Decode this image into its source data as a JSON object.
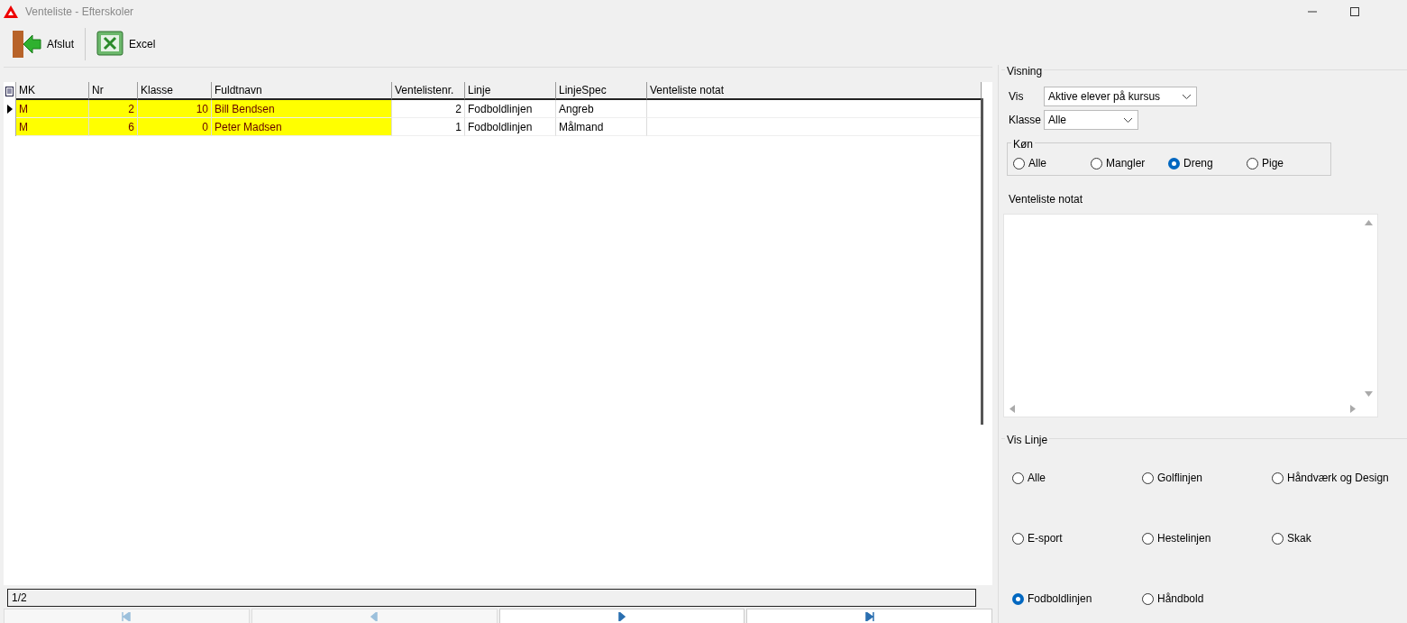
{
  "window": {
    "title": "Venteliste - Efterskoler"
  },
  "toolbar": [
    {
      "kind": "exit",
      "label": "Afslut"
    },
    {
      "kind": "excel",
      "label": "Excel"
    }
  ],
  "table": {
    "columns": [
      {
        "label": "MK",
        "numeric": false,
        "highlighted": true
      },
      {
        "label": "Nr",
        "numeric": true,
        "highlighted": true
      },
      {
        "label": "Klasse",
        "numeric": true,
        "highlighted": true
      },
      {
        "label": "Fuldtnavn",
        "numeric": false,
        "highlighted": true
      },
      {
        "label": "Ventelistenr.",
        "numeric": true,
        "highlighted": false
      },
      {
        "label": "Linje",
        "numeric": false,
        "highlighted": false
      },
      {
        "label": "LinjeSpec",
        "numeric": false,
        "highlighted": false
      },
      {
        "label": "Venteliste notat",
        "highlighted": false
      }
    ],
    "rows": [
      {
        "selected": true,
        "cells": [
          "M",
          "2",
          "10",
          "Bill Bendsen",
          "2",
          "Fodboldlinjen",
          "Angreb",
          ""
        ]
      },
      {
        "selected": false,
        "cells": [
          "M",
          "6",
          "0",
          "Peter Madsen",
          "1",
          "Fodboldlinjen",
          "Målmand",
          ""
        ]
      }
    ]
  },
  "status_bar": "1/2",
  "navigator": [
    {
      "kind": "first",
      "disabled": true
    },
    {
      "kind": "prev",
      "disabled": true
    },
    {
      "kind": "next",
      "disabled": false
    },
    {
      "kind": "last",
      "disabled": false
    }
  ],
  "visning": {
    "title": "Visning",
    "vis_label": "Vis",
    "vis_value": "Aktive elever på kursus",
    "klasse_label": "Klasse",
    "klasse_value": "Alle",
    "kon": {
      "title": "Køn",
      "options": [
        {
          "label": "Alle",
          "selected": false
        },
        {
          "label": "Mangler",
          "selected": false
        },
        {
          "label": "Dreng",
          "selected": true
        },
        {
          "label": "Pige",
          "selected": false
        }
      ]
    },
    "notat_label": "Venteliste notat"
  },
  "vis_linje": {
    "title": "Vis Linje",
    "options": [
      {
        "label": "Alle",
        "selected": false
      },
      {
        "label": "Golflinjen",
        "selected": false
      },
      {
        "label": "Håndværk og Design",
        "selected": false
      },
      {
        "label": "E-sport",
        "selected": false
      },
      {
        "label": "Hestelinjen",
        "selected": false
      },
      {
        "label": "Skak",
        "selected": false
      },
      {
        "label": "Fodboldlinjen",
        "selected": true
      },
      {
        "label": "Håndbold",
        "selected": false
      }
    ]
  }
}
